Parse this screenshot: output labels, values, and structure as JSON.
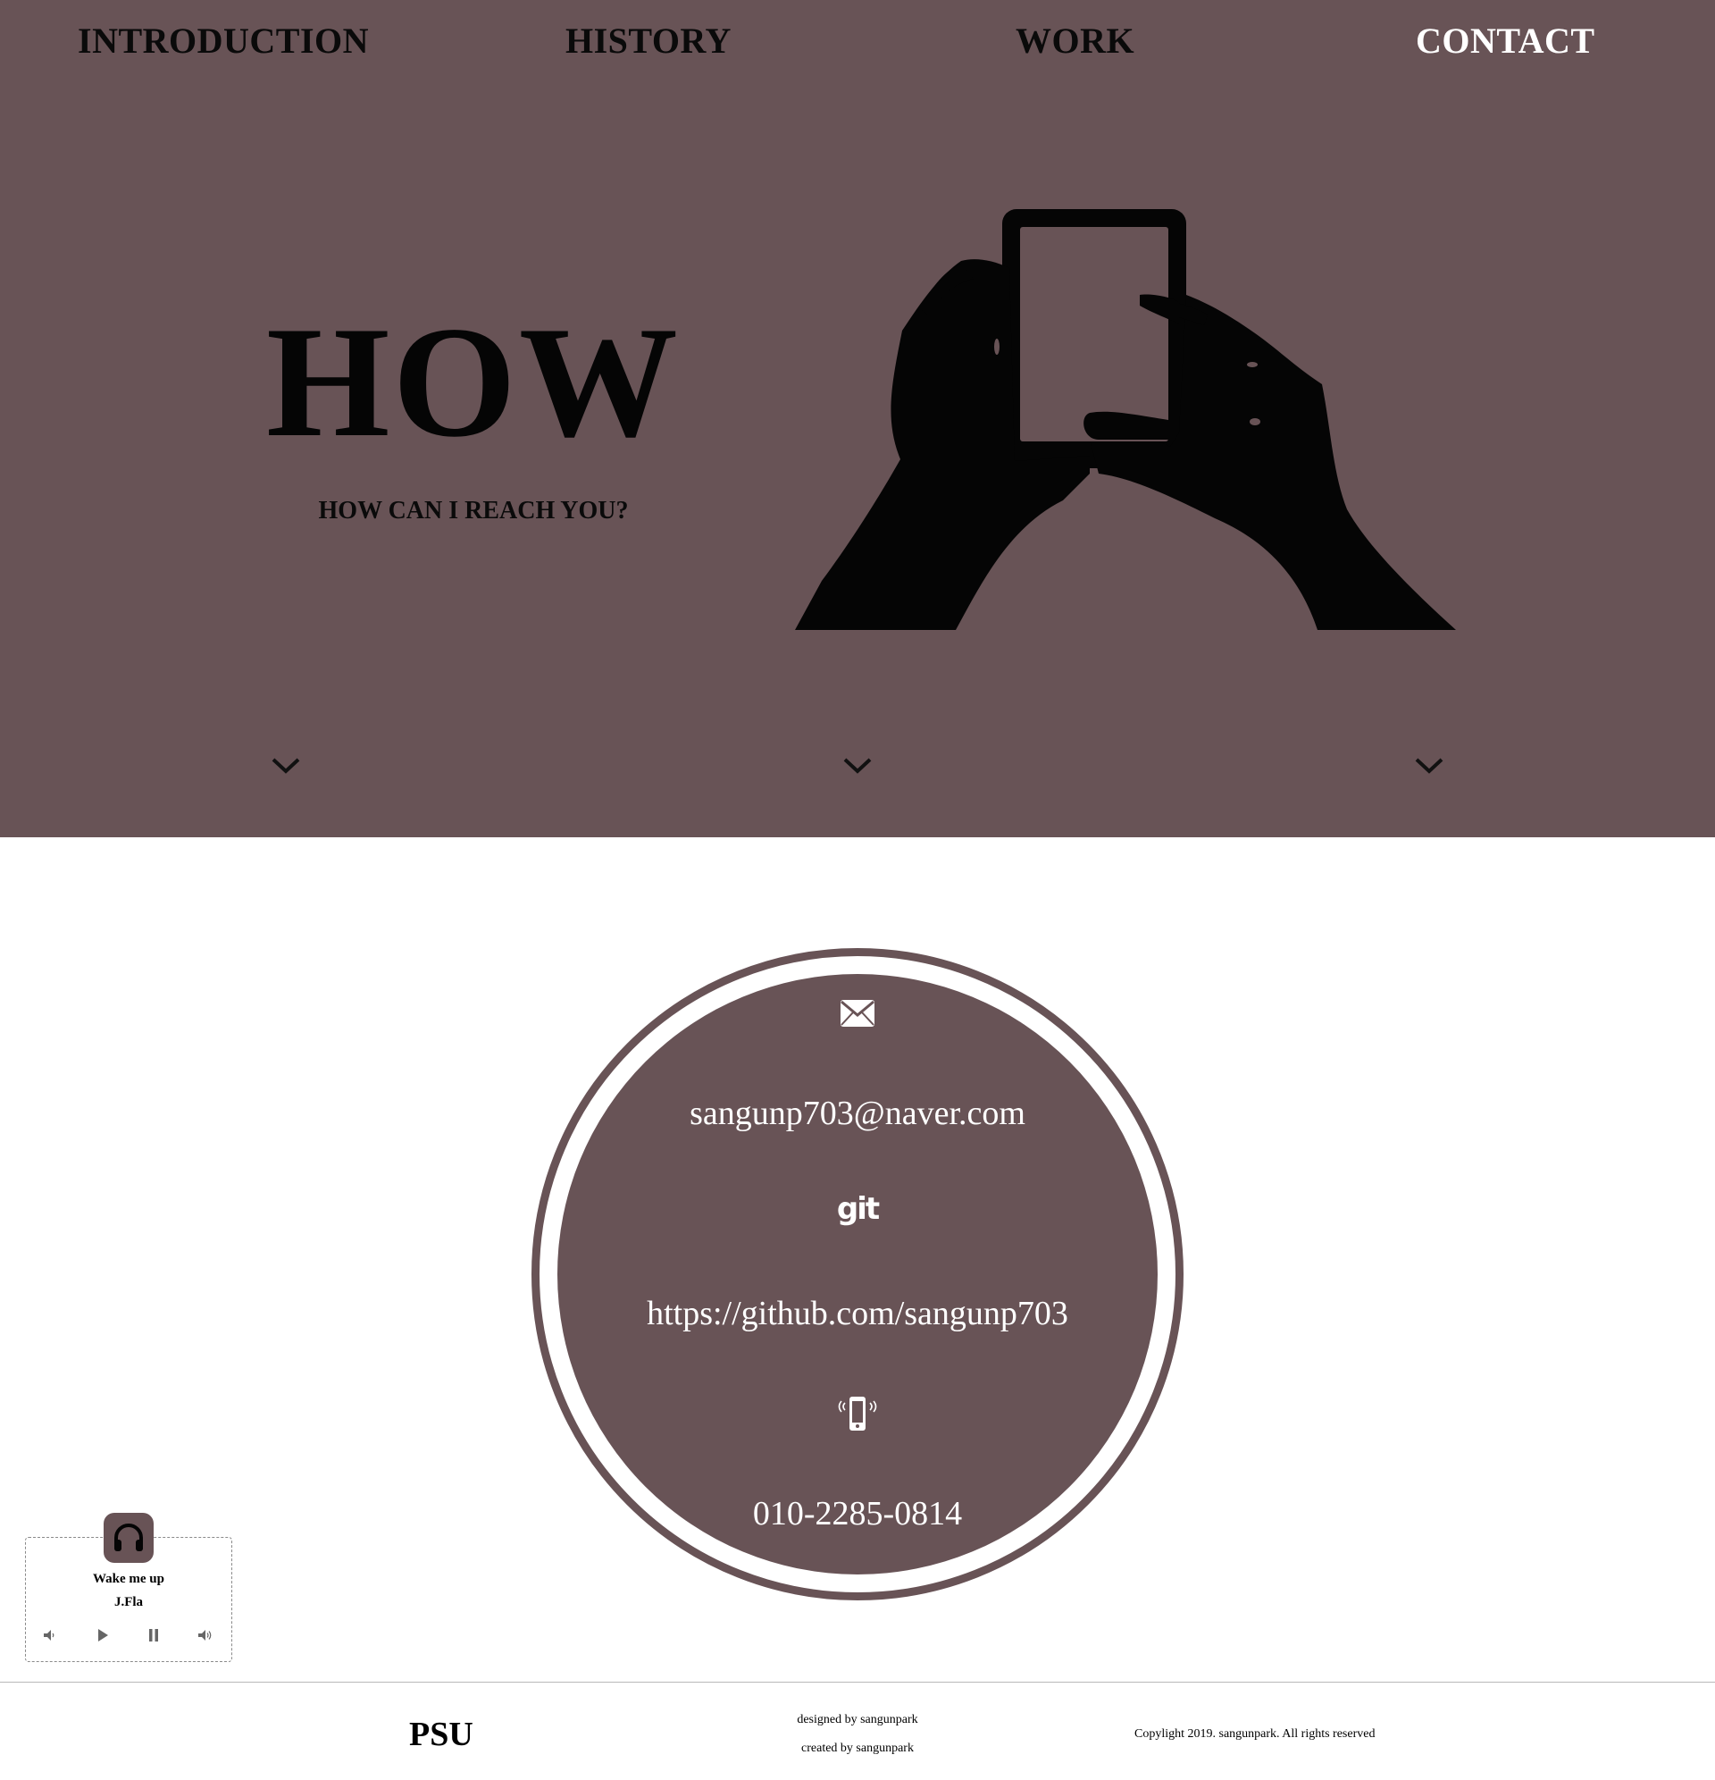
{
  "colors": {
    "accent": "#685356",
    "nav_text": "#0a0a0a",
    "nav_active": "#ffffff",
    "contact_text": "#ffffff"
  },
  "nav": {
    "items": [
      {
        "label": "INTRODUCTION"
      },
      {
        "label": "HISTORY"
      },
      {
        "label": "WORK"
      },
      {
        "label": "CONTACT",
        "active": true
      }
    ]
  },
  "hero": {
    "title": "HOW",
    "subtitle": "HOW CAN I REACH YOU?",
    "image_icon": "hands-holding-phone-silhouette",
    "scroll_icons": [
      "chevron-down-icon",
      "chevron-down-icon",
      "chevron-down-icon"
    ]
  },
  "contact": {
    "email_icon": "envelope-icon",
    "email": "sangunp703@naver.com",
    "git_icon": "git-icon",
    "git_label": "git",
    "github": "https://github.com/sangunp703",
    "phone_icon": "phone-vibrate-icon",
    "phone": "010-2285-0814"
  },
  "player": {
    "icon": "headphones-icon",
    "title": "Wake me up",
    "artist": "J.Fla",
    "controls": [
      "volume-down-icon",
      "play-icon",
      "pause-icon",
      "volume-up-icon"
    ]
  },
  "footer": {
    "logo": "PSU",
    "designed": "designed by sangunpark",
    "created": "created by sangunpark",
    "copyright": "Copylight 2019. sangunpark. All rights reserved"
  }
}
